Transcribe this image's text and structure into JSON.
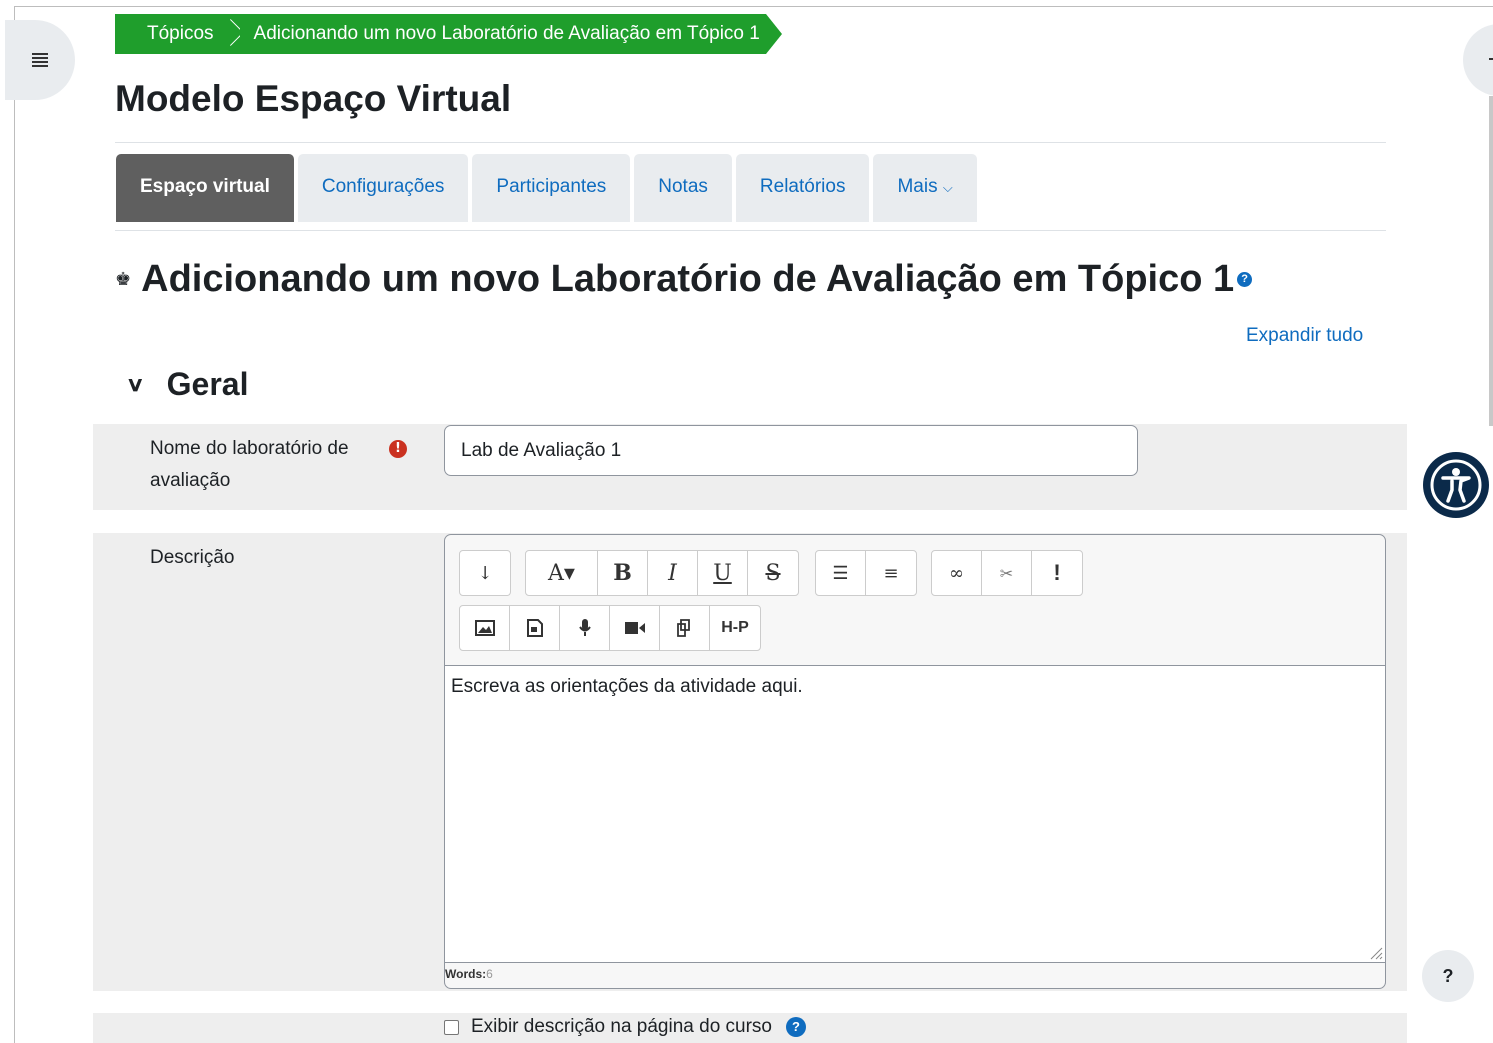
{
  "breadcrumb": {
    "items": [
      "Tópicos",
      "Adicionando um novo Laboratório de Avaliação em Tópico 1"
    ]
  },
  "course": {
    "title": "Modelo Espaço Virtual"
  },
  "tabs": [
    {
      "label": "Espaço virtual",
      "active": true
    },
    {
      "label": "Configurações"
    },
    {
      "label": "Participantes"
    },
    {
      "label": "Notas"
    },
    {
      "label": "Relatórios"
    },
    {
      "label": "Mais",
      "icon": "chevron-down-icon"
    }
  ],
  "page": {
    "heading": "Adicionando um novo Laboratório de Avaliação em Tópico 1",
    "expand_all": "Expandir tudo"
  },
  "section": {
    "title": "Geral"
  },
  "form": {
    "name_label": "Nome do laboratório de avaliação",
    "name_value": "Lab de Avaliação 1",
    "description_label": "Descrição",
    "description_text": "Escreva as orientações da atividade aqui.",
    "words_label": "Words:",
    "words_count": "6",
    "show_description_label": "Exibir descrição na página do curso"
  },
  "toolbar": {
    "row1": [
      [
        "toggle-more-icon"
      ],
      [
        "font-style-icon",
        "bold-icon",
        "italic-icon",
        "underline-icon",
        "strikethrough-icon"
      ],
      [
        "unordered-list-icon",
        "ordered-list-icon"
      ],
      [
        "link-icon",
        "unlink-icon",
        "emoji-important-icon"
      ]
    ],
    "row2": [
      [
        "image-icon",
        "media-icon",
        "record-audio-icon",
        "record-video-icon",
        "manage-files-icon",
        "h5p-icon"
      ]
    ]
  },
  "colors": {
    "breadcrumb_bg": "#1f9e2c",
    "link": "#0f6cbf",
    "active_tab": "#5f5f5f",
    "required": "#ca3120",
    "accessibility_bg": "#0b2a4a"
  }
}
